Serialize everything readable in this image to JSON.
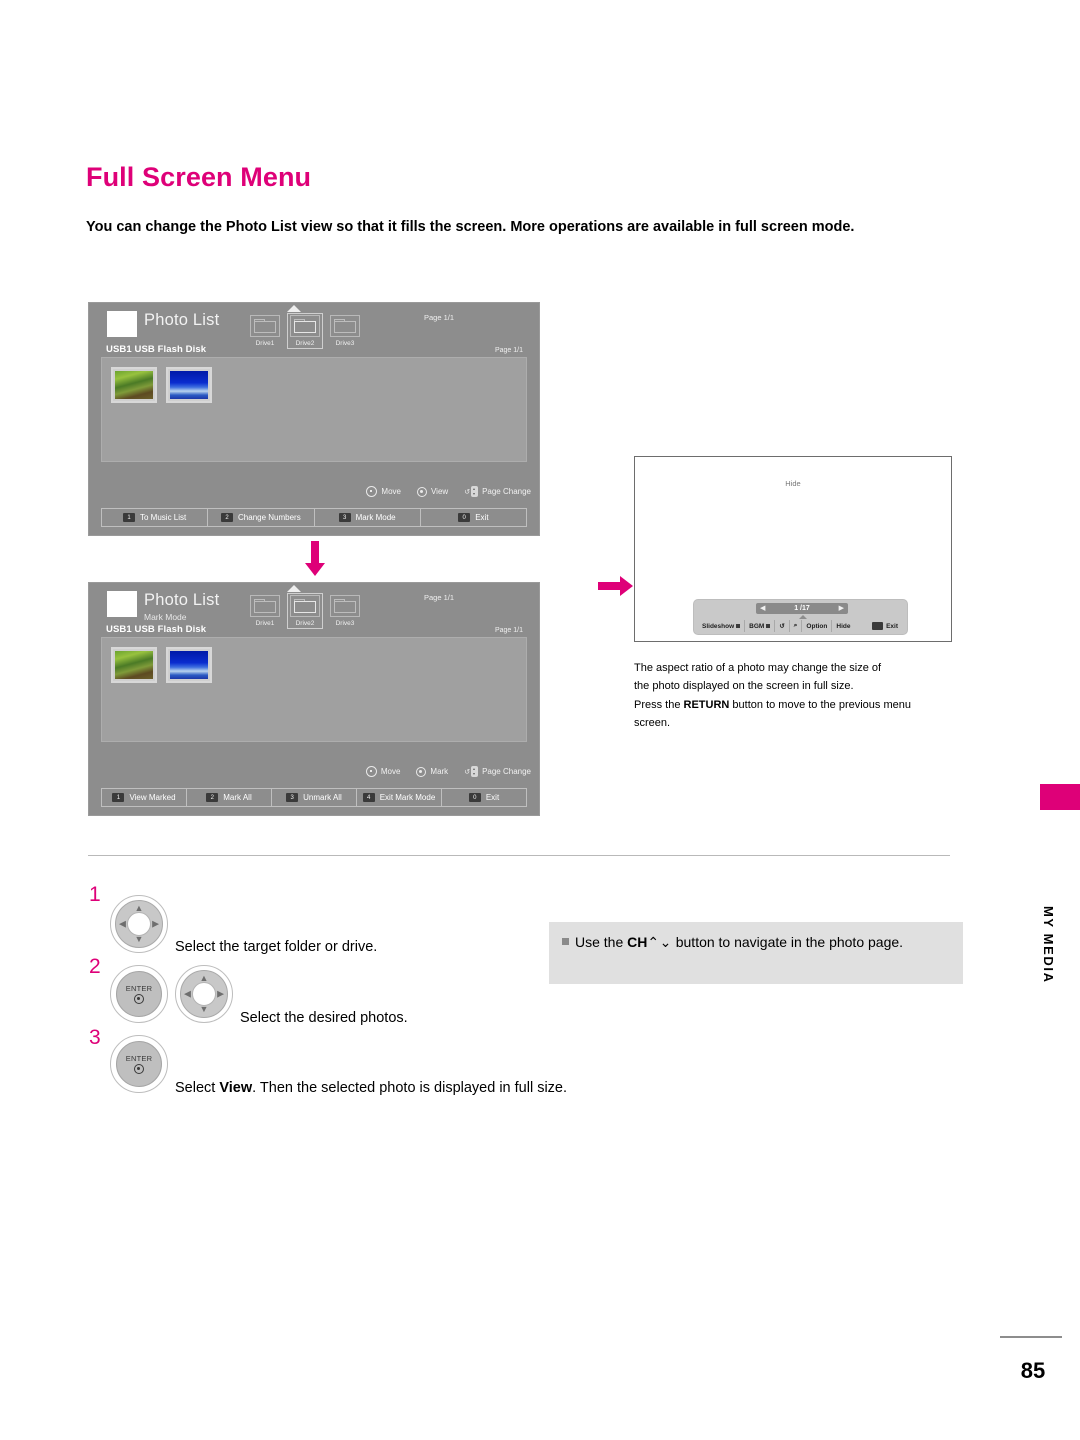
{
  "heading": {
    "title": "Full Screen Menu",
    "intro": "You can change the Photo List view so that it fills the screen. More operations are available in full screen mode."
  },
  "tv_photo_list": {
    "title": "Photo List",
    "subtitle": "",
    "source": "USB1 USB Flash Disk",
    "page_top": "Page 1/1",
    "page_inner": "Page 1/1",
    "drives": [
      {
        "label": "Drive1"
      },
      {
        "label": "Drive2"
      },
      {
        "label": "Drive3"
      }
    ],
    "hints": [
      {
        "icon": "dpad-icon",
        "label": "Move"
      },
      {
        "icon": "ok-icon",
        "label": "View"
      },
      {
        "icon": "ch-updown-icon",
        "label": "Page Change"
      }
    ],
    "color_buttons": [
      {
        "num": "1",
        "label": "To Music List"
      },
      {
        "num": "2",
        "label": "Change Numbers"
      },
      {
        "num": "3",
        "label": "Mark Mode"
      },
      {
        "num": "0",
        "label": "Exit"
      }
    ]
  },
  "tv_mark_mode": {
    "title": "Photo List",
    "subtitle": "Mark Mode",
    "source": "USB1 USB Flash Disk",
    "page_top": "Page 1/1",
    "page_inner": "Page 1/1",
    "drives": [
      {
        "label": "Drive1"
      },
      {
        "label": "Drive2"
      },
      {
        "label": "Drive3"
      }
    ],
    "hints": [
      {
        "icon": "dpad-icon",
        "label": "Move"
      },
      {
        "icon": "ok-icon",
        "label": "Mark"
      },
      {
        "icon": "ch-updown-icon",
        "label": "Page Change"
      }
    ],
    "color_buttons": [
      {
        "num": "1",
        "label": "View Marked"
      },
      {
        "num": "2",
        "label": "Mark All"
      },
      {
        "num": "3",
        "label": "Unmark All"
      },
      {
        "num": "4",
        "label": "Exit Mark Mode"
      },
      {
        "num": "0",
        "label": "Exit"
      }
    ]
  },
  "fullscreen": {
    "hide_label": "Hide",
    "pager": {
      "prev": "◀",
      "label": "1 /17",
      "next": "▶"
    },
    "menu": [
      {
        "label": "Slideshow",
        "icon": "square-marker-icon"
      },
      {
        "label": "BGM",
        "icon": "square-marker-icon"
      },
      {
        "label": "↺",
        "icon": "rotate-icon"
      },
      {
        "label": "⌕",
        "icon": "zoom-icon"
      },
      {
        "label": "Option",
        "icon": ""
      },
      {
        "label": "Hide",
        "icon": ""
      }
    ],
    "exit_label": "Exit",
    "note_line1": "The aspect ratio of a photo may change the size of",
    "note_line2": "the photo displayed on the screen in full size.",
    "note_line3_pre": "Press the ",
    "note_line3_bold": "RETURN",
    "note_line3_post": " button to move to the previous menu",
    "note_line4": "screen."
  },
  "steps": [
    {
      "num": "1",
      "text": "Select the target folder or drive.",
      "icons": [
        "dpad-remote-icon"
      ]
    },
    {
      "num": "2",
      "text": "Select the desired photos.",
      "icons": [
        "enter-button-icon",
        "dpad-remote-icon"
      ]
    },
    {
      "num": "3",
      "text_pre": "Select ",
      "text_bold": "View",
      "text_post": ". Then the selected photo is displayed in full size.",
      "icons": [
        "enter-button-icon"
      ]
    }
  ],
  "enter_label": "ENTER",
  "note_box": {
    "pre": "Use the ",
    "bold": "CH",
    "glyph": "⌃⌄",
    "post": " button to navigate in the photo page."
  },
  "side_tab": {
    "label": "MY MEDIA",
    "color": "#DE0078"
  },
  "footer": {
    "page_number": "85"
  },
  "colors": {
    "accent": "#DE0078",
    "tv_bg": "#8d8d8d",
    "tv_content_bg": "#a0a0a0",
    "note_bg": "#e0e0e0"
  }
}
